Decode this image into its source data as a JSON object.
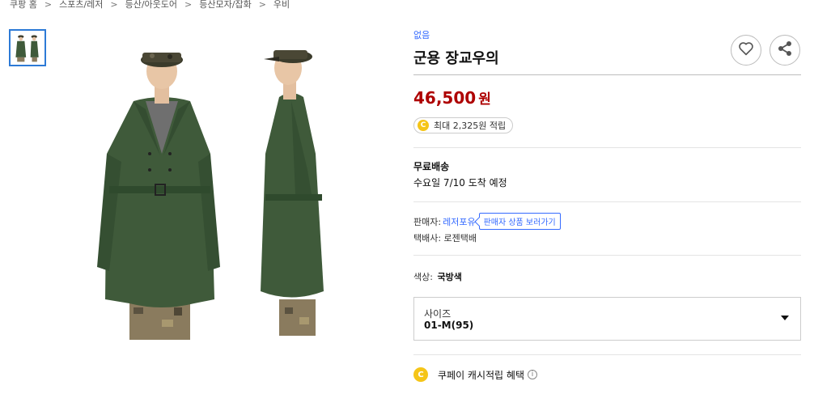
{
  "breadcrumb": [
    "쿠팡 홈",
    "스포츠/레저",
    "등산/아웃도어",
    "등산모자/잡화",
    "우비"
  ],
  "breadcrumb_separator": ">",
  "product": {
    "brand": "없음",
    "title": "군용 장교우의",
    "price_number": "46,500",
    "price_unit": "원",
    "reward_text": "최대 2,325원 적립",
    "reward_coin_label": "C"
  },
  "shipping": {
    "title": "무료배송",
    "date": "수요일 7/10 도착 예정"
  },
  "seller": {
    "label": "판매자:",
    "name": "레저포유",
    "link_label": "판매자 상품 보러가기",
    "courier": "택배사: 로젠택배"
  },
  "option": {
    "color_label": "색상:",
    "color_value": "국방색",
    "size_label": "사이즈",
    "size_value": "01-M(95)"
  },
  "cash": {
    "text": "쿠페이 캐시적립 혜택",
    "coin_label": "C",
    "info_label": "i"
  },
  "colors": {
    "accent_blue": "#346aff",
    "price_red": "#ae0000",
    "coat_green": "#3f5a3a",
    "coin_yellow": "#f5c518"
  },
  "icons": [
    "heart-icon",
    "share-icon",
    "coin-icon",
    "info-icon",
    "dropdown-arrow-icon"
  ]
}
